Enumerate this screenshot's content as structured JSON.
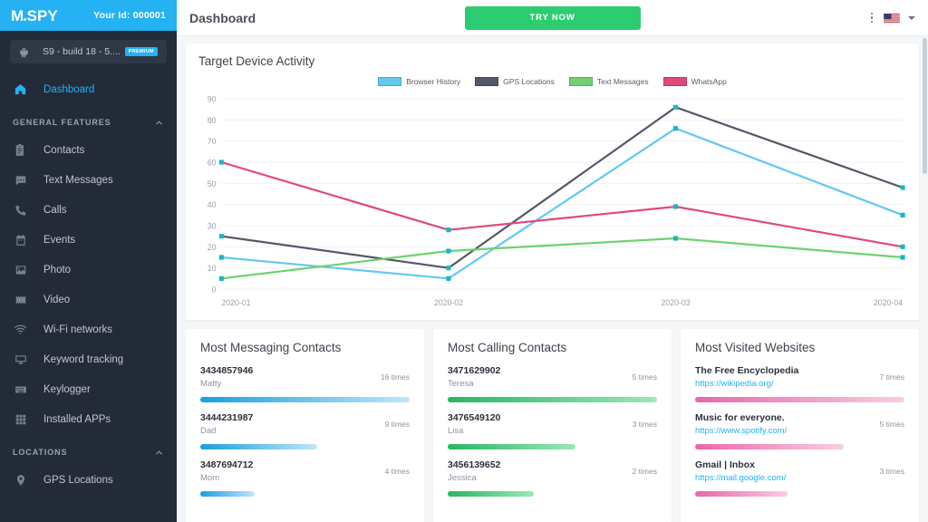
{
  "brand": {
    "logo_m": "M",
    "logo_spy": "SPY",
    "user_id": "Your Id: 000001",
    "accent_blue": "#24b2f3",
    "sidebar_bg": "#232b39"
  },
  "device": {
    "name": "S9 - build 18 - 5....",
    "badge": "PREMIUM",
    "icon": "android-icon"
  },
  "sidebar": {
    "primary": [
      {
        "label": "Dashboard",
        "icon": "home-icon",
        "active": true
      }
    ],
    "sections": [
      {
        "title": "GENERAL FEATURES",
        "collapse_icon": "chevron-up-icon",
        "items": [
          {
            "label": "Contacts",
            "icon": "contacts-icon"
          },
          {
            "label": "Text Messages",
            "icon": "message-icon"
          },
          {
            "label": "Calls",
            "icon": "phone-icon"
          },
          {
            "label": "Events",
            "icon": "calendar-icon"
          },
          {
            "label": "Photo",
            "icon": "image-icon"
          },
          {
            "label": "Video",
            "icon": "video-icon"
          },
          {
            "label": "Wi-Fi networks",
            "icon": "wifi-icon"
          },
          {
            "label": "Keyword tracking",
            "icon": "monitor-icon"
          },
          {
            "label": "Keylogger",
            "icon": "keyboard-icon"
          },
          {
            "label": "Installed APPs",
            "icon": "grid-icon"
          }
        ]
      },
      {
        "title": "LOCATIONS",
        "collapse_icon": "chevron-up-icon",
        "items": [
          {
            "label": "GPS Locations",
            "icon": "map-pin-icon"
          }
        ]
      }
    ]
  },
  "topbar": {
    "title": "Dashboard",
    "cta_label": "TRY NOW",
    "cta_color": "#2ecc71",
    "kebab_icon": "more-vertical-icon",
    "flag_icon": "us-flag-icon",
    "caret_icon": "chevron-down-icon"
  },
  "chart_data": {
    "type": "line",
    "title": "Target Device Activity",
    "xlabel": "",
    "ylabel": "",
    "x": [
      "2020-01",
      "2020-02",
      "2020-03",
      "2020-04"
    ],
    "ylim": [
      0,
      90
    ],
    "yticks": [
      0,
      10,
      20,
      30,
      40,
      50,
      60,
      70,
      80,
      90
    ],
    "grid": true,
    "legend_position": "top-center",
    "marker_color": "#17b8c4",
    "series": [
      {
        "name": "Browser History",
        "color": "#64c8f0",
        "values": [
          15,
          5,
          76,
          35
        ]
      },
      {
        "name": "GPS Locations",
        "color": "#515a68",
        "values": [
          25,
          10,
          86,
          48
        ]
      },
      {
        "name": "Text Messages",
        "color": "#6fd16f",
        "values": [
          5,
          18,
          24,
          15
        ]
      },
      {
        "name": "WhatsApp",
        "color": "#e1487f",
        "values": [
          60,
          28,
          39,
          20
        ]
      }
    ]
  },
  "cards": [
    {
      "title": "Most Messaging Contacts",
      "bar_from": "#1a9fe0",
      "bar_to": "#bfe6fa",
      "entries": [
        {
          "primary": "3434857946",
          "secondary": "Matty",
          "count": "16 times",
          "pct": 100
        },
        {
          "primary": "3444231987",
          "secondary": "Dad",
          "count": "9 times",
          "pct": 56
        },
        {
          "primary": "3487694712",
          "secondary": "Mom",
          "count": "4 times",
          "pct": 26
        }
      ]
    },
    {
      "title": "Most Calling Contacts",
      "bar_from": "#27b662",
      "bar_to": "#9ae8b8",
      "entries": [
        {
          "primary": "3471629902",
          "secondary": "Teresa",
          "count": "5 times",
          "pct": 100
        },
        {
          "primary": "3476549120",
          "secondary": "Lisa",
          "count": "3 times",
          "pct": 61
        },
        {
          "primary": "3456139652",
          "secondary": "Jessica",
          "count": "2 times",
          "pct": 41
        }
      ]
    },
    {
      "title": "Most Visited Websites",
      "bar_from": "#e967a8",
      "bar_to": "#f8cde4",
      "entries": [
        {
          "primary": "The Free Encyclopedia",
          "secondary": "https://wikipedia.org/",
          "count": "7 times",
          "pct": 100,
          "is_link": true
        },
        {
          "primary": "Music for everyone.",
          "secondary": "https://www.spotify.com/",
          "count": "5 times",
          "pct": 71,
          "is_link": true
        },
        {
          "primary": "Gmail | Inbox",
          "secondary": "https://mail.google.com/",
          "count": "3 times",
          "pct": 44,
          "is_link": true
        }
      ]
    }
  ]
}
